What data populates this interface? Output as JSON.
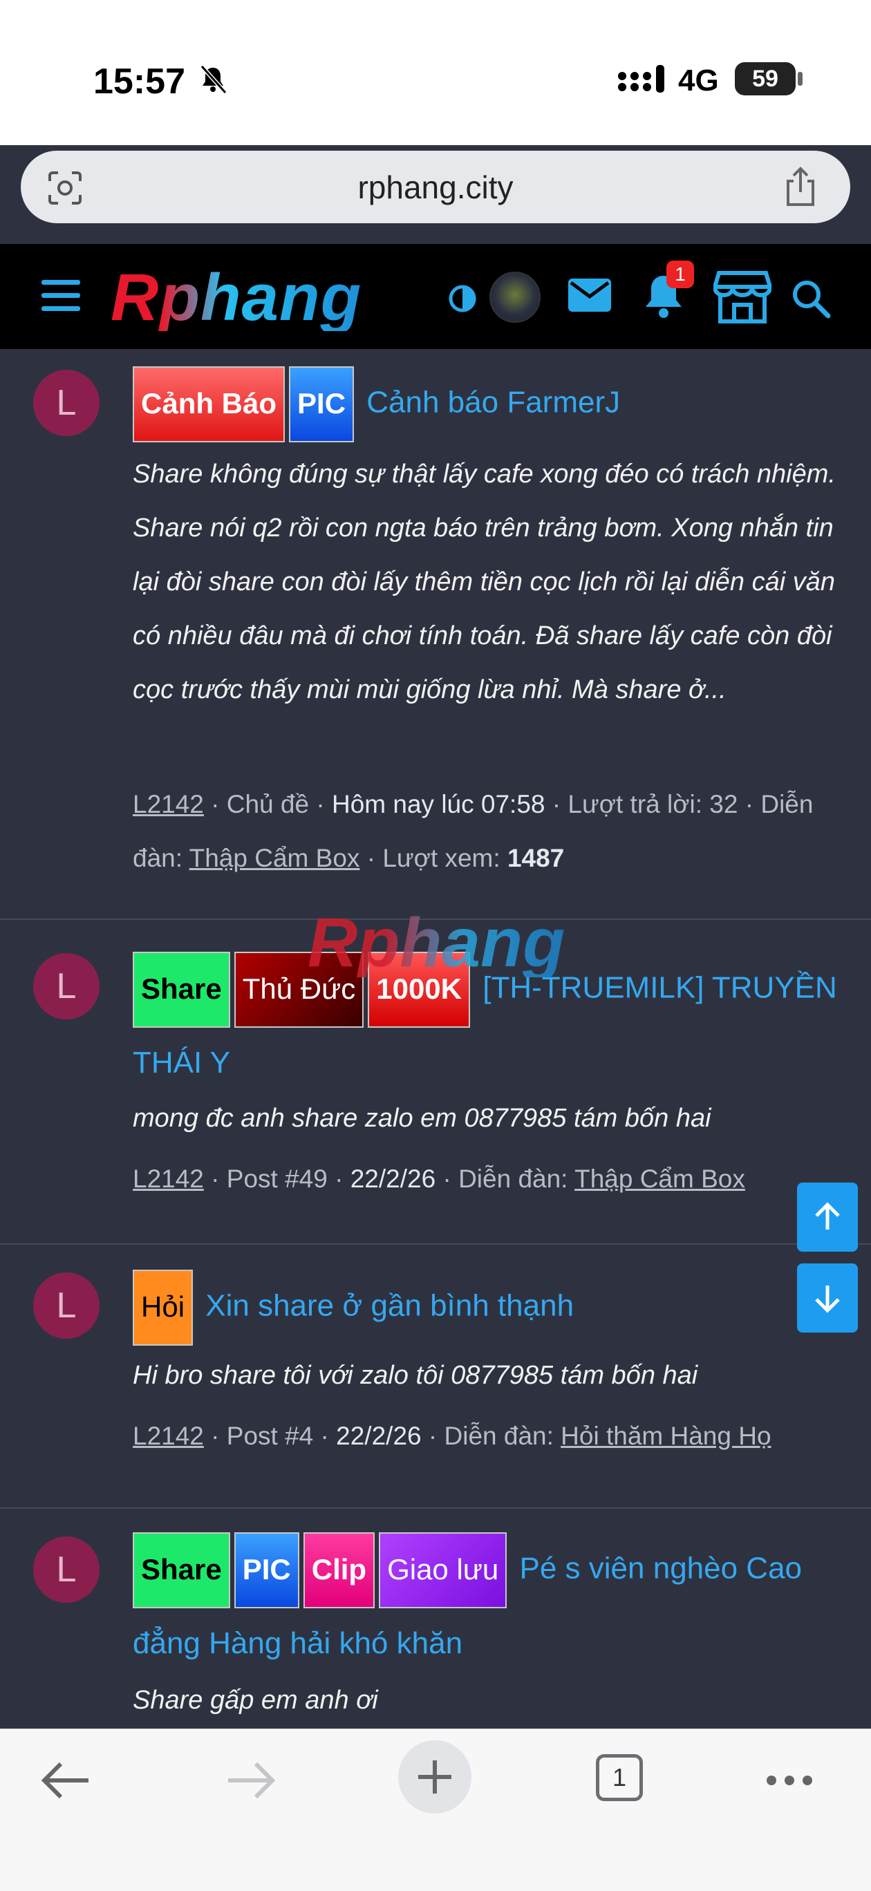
{
  "status": {
    "time": "15:57",
    "network": "4G",
    "battery": "59"
  },
  "browser": {
    "url": "rphang.city"
  },
  "header": {
    "logo": "Rphang",
    "notification_count": "1"
  },
  "watermark": "Rphang",
  "posts": [
    {
      "avatar": "L",
      "labels": [
        "Cảnh Báo",
        "PIC"
      ],
      "title": "Cảnh báo FarmerJ",
      "excerpt": "Share không đúng sự thật lấy cafe xong đéo có trách nhiệm. Share nói q2 rồi con ngta báo trên trảng bơm. Xong nhắn tin lại đòi share con đòi lấy thêm tiền cọc lịch rồi lại diễn cái văn có nhiều đâu mà đi chơi tính toán. Đã share lấy cafe còn đòi cọc trước thấy mùi mùi giống lừa nhỉ. Mà share ở...",
      "meta": {
        "user": "L2142",
        "type": "Chủ đề",
        "date": "Hôm nay lúc 07:58",
        "replies_label": "Lượt trả lời:",
        "replies": "32",
        "forum_label": "Diễn đàn:",
        "forum": "Thập Cẩm Box",
        "views_label": "Lượt xem:",
        "views": "1487"
      }
    },
    {
      "avatar": "L",
      "labels": [
        "Share",
        "Thủ Đức",
        "1000K"
      ],
      "title": "[TH-TRUEMILK] TRUYỀN THÁI Y",
      "excerpt": "mong đc anh share zalo em 0877985 tám bốn hai",
      "meta": {
        "user": "L2142",
        "post": "Post #49",
        "date": "22/2/26",
        "forum_label": "Diễn đàn:",
        "forum": "Thập Cẩm Box"
      }
    },
    {
      "avatar": "L",
      "labels": [
        "Hỏi"
      ],
      "title": "Xin share ở gần bình thạnh",
      "excerpt": "Hi bro share tôi với zalo tôi 0877985 tám bốn hai",
      "meta": {
        "user": "L2142",
        "post": "Post #4",
        "date": "22/2/26",
        "forum_label": "Diễn đàn:",
        "forum": "Hỏi thăm Hàng Họ"
      }
    },
    {
      "avatar": "L",
      "labels": [
        "Share",
        "PIC",
        "Clip",
        "Giao lưu"
      ],
      "title": "Pé s viên nghèo Cao đẳng Hàng hải khó khăn",
      "excerpt": "Share gấp em anh ơi"
    }
  ],
  "bottom": {
    "tab_count": "1"
  }
}
